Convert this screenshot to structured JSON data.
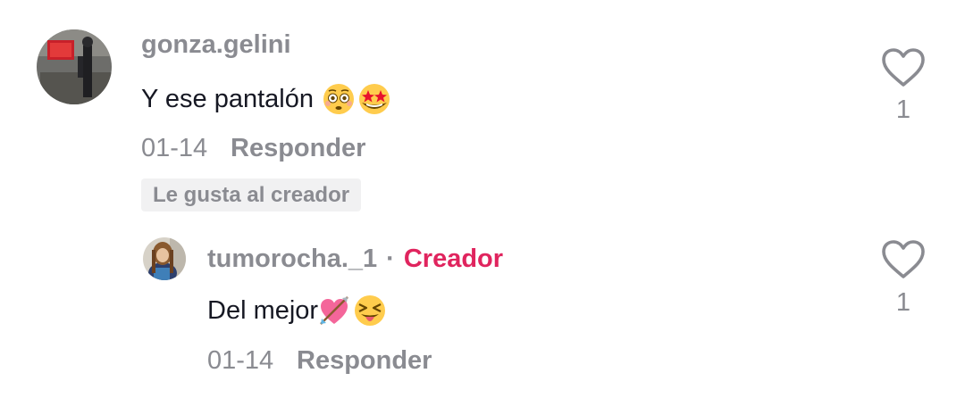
{
  "comments": [
    {
      "username": "gonza.gelini",
      "text": "Y ese pantalón",
      "emojis": [
        "flushed-face-emoji",
        "star-struck-emoji"
      ],
      "date": "01-14",
      "reply_label": "Responder",
      "badge": "Le gusta al creador",
      "like_count": "1"
    }
  ],
  "reply": {
    "username": "tumorocha._1",
    "separator": "·",
    "role_label": "Creador",
    "text": "Del mejor",
    "emojis": [
      "heart-with-arrow-emoji",
      "squinting-tongue-emoji"
    ],
    "date": "01-14",
    "reply_label": "Responder",
    "like_count": "1"
  },
  "colors": {
    "creator": "#e0245e",
    "muted": "#8a8b91",
    "text": "#161823"
  }
}
